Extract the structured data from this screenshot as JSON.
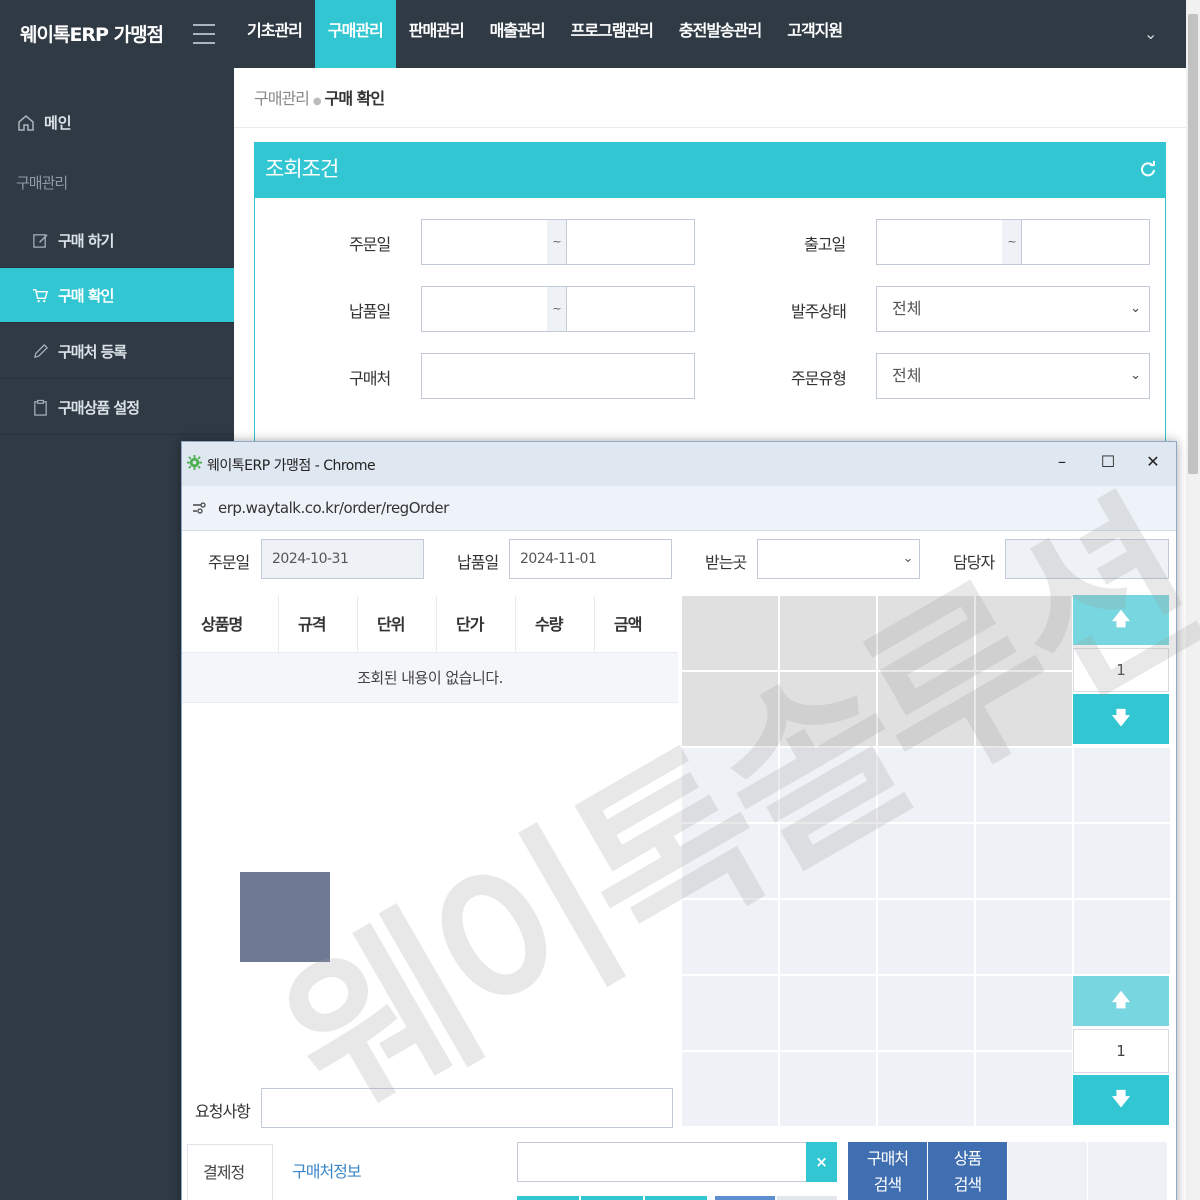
{
  "brand": "웨이톡ERP 가맹점",
  "nav": [
    {
      "label": "기초관리",
      "active": false
    },
    {
      "label": "구매관리",
      "active": true
    },
    {
      "label": "판매관리",
      "active": false
    },
    {
      "label": "매출관리",
      "active": false
    },
    {
      "label": "프로그램관리",
      "active": false
    },
    {
      "label": "충전발송관리",
      "active": false
    },
    {
      "label": "고객지원",
      "active": false
    }
  ],
  "sidebar": {
    "home": "메인",
    "section": "구매관리",
    "items": [
      {
        "label": "구매 하기",
        "icon": "edit-icon",
        "active": false
      },
      {
        "label": "구매 확인",
        "icon": "cart-icon",
        "active": true
      },
      {
        "label": "구매처 등록",
        "icon": "pencil-icon",
        "active": false
      },
      {
        "label": "구매상품 설정",
        "icon": "clipboard-icon",
        "active": false
      }
    ]
  },
  "breadcrumb": {
    "parent": "구매관리",
    "current": "구매 확인"
  },
  "search_panel": {
    "title": "조회조건",
    "order_date_label": "주문일",
    "ship_date_label": "출고일",
    "delivery_date_label": "납품일",
    "order_status_label": "발주상태",
    "order_status_value": "전체",
    "vendor_label": "구매처",
    "order_type_label": "주문유형",
    "order_type_value": "전체",
    "tilde": "~"
  },
  "popup": {
    "window_title": "웨이톡ERP 가맹점 - Chrome",
    "url": "erp.waytalk.co.kr/order/regOrder",
    "order_date_label": "주문일",
    "order_date_value": "2024-10-31",
    "delivery_date_label": "납품일",
    "delivery_date_value": "2024-11-01",
    "receiver_label": "받는곳",
    "manager_label": "담당자",
    "table_headers": [
      "상품명",
      "규격",
      "단위",
      "단가",
      "수량",
      "금액"
    ],
    "empty_message": "조회된 내용이 없습니다.",
    "page_top": "1",
    "page_bottom": "1",
    "request_label": "요청사항",
    "tab_payment": "결제정보",
    "tab_vendor": "구매처정보",
    "clear_label": "×",
    "vendor_search_line1": "구매처",
    "vendor_search_line2": "검색",
    "product_search_line1": "상품",
    "product_search_line2": "검색"
  },
  "watermark": "웨이톡솔루션",
  "colors": {
    "accent": "#32c5d2",
    "sidebar": "#2f3a45",
    "button_blue": "#3f6fb0"
  }
}
